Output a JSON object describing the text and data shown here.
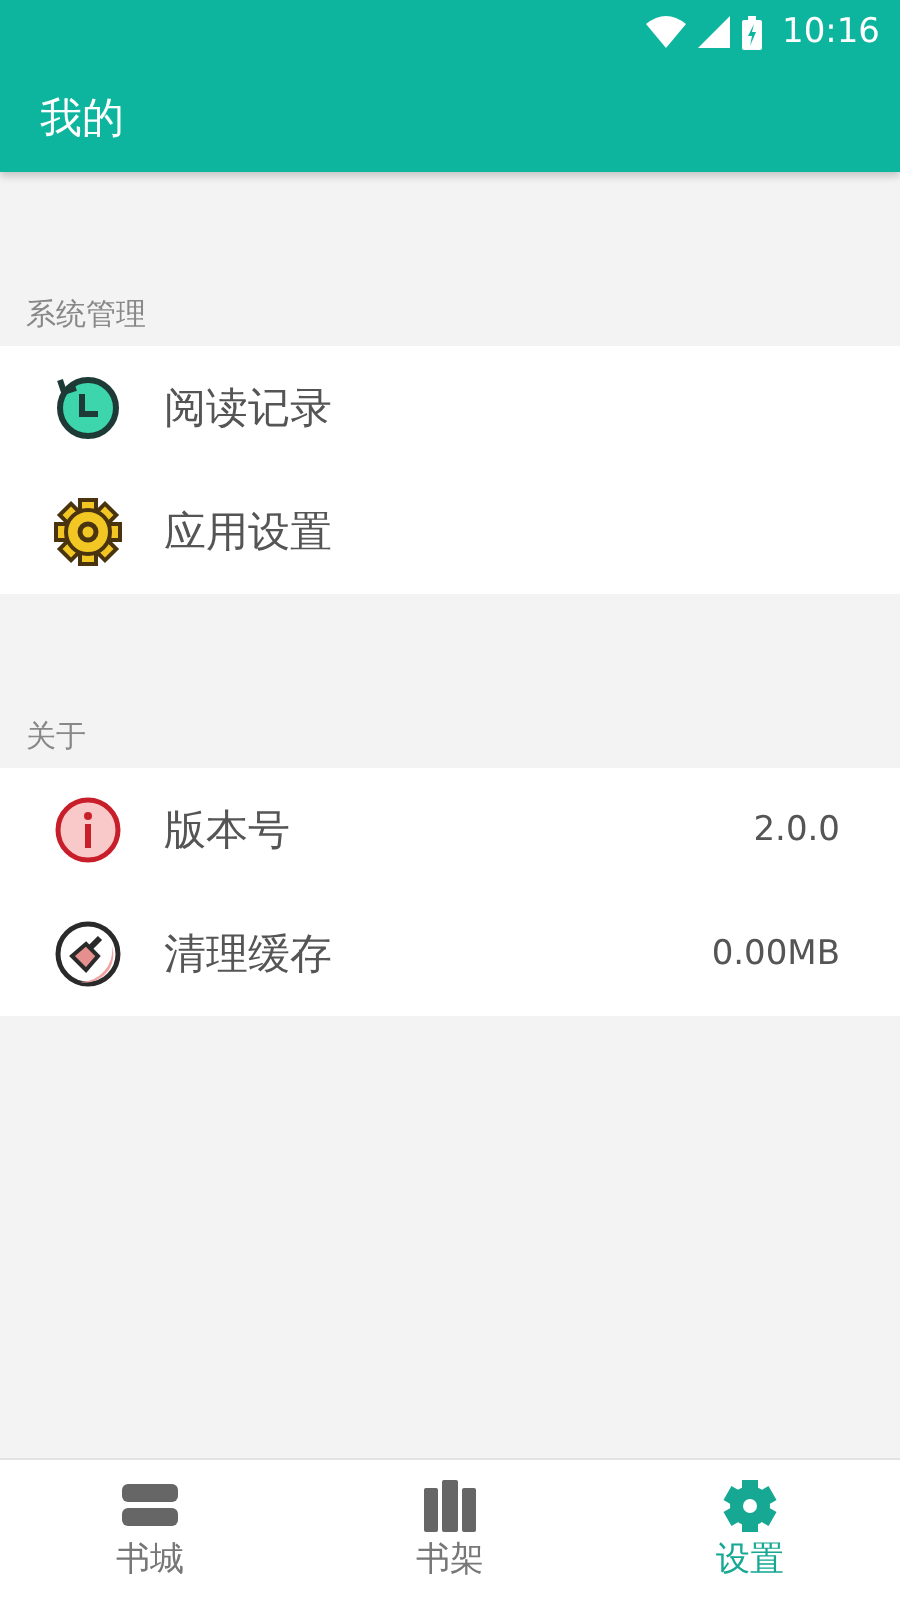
{
  "status_bar": {
    "time": "10:16"
  },
  "app_bar": {
    "title": "我的"
  },
  "sections": [
    {
      "header": "系统管理",
      "items": [
        {
          "kind": "history",
          "label": "阅读记录"
        },
        {
          "kind": "gear",
          "label": "应用设置"
        }
      ]
    },
    {
      "header": "关于",
      "items": [
        {
          "kind": "info",
          "label": "版本号",
          "value": "2.0.0"
        },
        {
          "kind": "broom",
          "label": "清理缓存",
          "value": "0.00MB"
        }
      ]
    }
  ],
  "bottom_nav": [
    {
      "kind": "books",
      "label": "书城",
      "selected": false
    },
    {
      "kind": "shelf",
      "label": "书架",
      "selected": false
    },
    {
      "kind": "settings",
      "label": "设置",
      "selected": true
    }
  ]
}
